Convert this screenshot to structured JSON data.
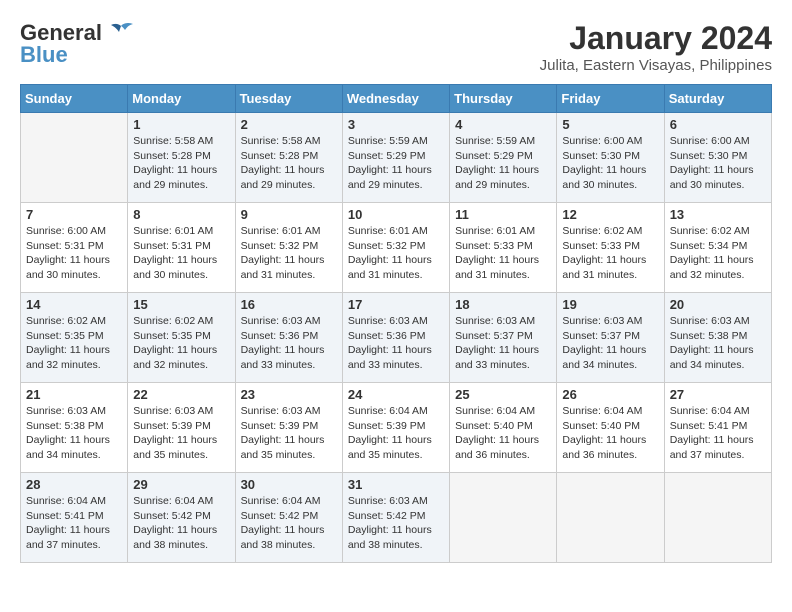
{
  "logo": {
    "general": "General",
    "blue": "Blue"
  },
  "title": "January 2024",
  "subtitle": "Julita, Eastern Visayas, Philippines",
  "headers": [
    "Sunday",
    "Monday",
    "Tuesday",
    "Wednesday",
    "Thursday",
    "Friday",
    "Saturday"
  ],
  "weeks": [
    [
      {
        "day": "",
        "info": ""
      },
      {
        "day": "1",
        "info": "Sunrise: 5:58 AM\nSunset: 5:28 PM\nDaylight: 11 hours and 29 minutes."
      },
      {
        "day": "2",
        "info": "Sunrise: 5:58 AM\nSunset: 5:28 PM\nDaylight: 11 hours and 29 minutes."
      },
      {
        "day": "3",
        "info": "Sunrise: 5:59 AM\nSunset: 5:29 PM\nDaylight: 11 hours and 29 minutes."
      },
      {
        "day": "4",
        "info": "Sunrise: 5:59 AM\nSunset: 5:29 PM\nDaylight: 11 hours and 29 minutes."
      },
      {
        "day": "5",
        "info": "Sunrise: 6:00 AM\nSunset: 5:30 PM\nDaylight: 11 hours and 30 minutes."
      },
      {
        "day": "6",
        "info": "Sunrise: 6:00 AM\nSunset: 5:30 PM\nDaylight: 11 hours and 30 minutes."
      }
    ],
    [
      {
        "day": "7",
        "info": "Sunrise: 6:00 AM\nSunset: 5:31 PM\nDaylight: 11 hours and 30 minutes."
      },
      {
        "day": "8",
        "info": "Sunrise: 6:01 AM\nSunset: 5:31 PM\nDaylight: 11 hours and 30 minutes."
      },
      {
        "day": "9",
        "info": "Sunrise: 6:01 AM\nSunset: 5:32 PM\nDaylight: 11 hours and 31 minutes."
      },
      {
        "day": "10",
        "info": "Sunrise: 6:01 AM\nSunset: 5:32 PM\nDaylight: 11 hours and 31 minutes."
      },
      {
        "day": "11",
        "info": "Sunrise: 6:01 AM\nSunset: 5:33 PM\nDaylight: 11 hours and 31 minutes."
      },
      {
        "day": "12",
        "info": "Sunrise: 6:02 AM\nSunset: 5:33 PM\nDaylight: 11 hours and 31 minutes."
      },
      {
        "day": "13",
        "info": "Sunrise: 6:02 AM\nSunset: 5:34 PM\nDaylight: 11 hours and 32 minutes."
      }
    ],
    [
      {
        "day": "14",
        "info": "Sunrise: 6:02 AM\nSunset: 5:35 PM\nDaylight: 11 hours and 32 minutes."
      },
      {
        "day": "15",
        "info": "Sunrise: 6:02 AM\nSunset: 5:35 PM\nDaylight: 11 hours and 32 minutes."
      },
      {
        "day": "16",
        "info": "Sunrise: 6:03 AM\nSunset: 5:36 PM\nDaylight: 11 hours and 33 minutes."
      },
      {
        "day": "17",
        "info": "Sunrise: 6:03 AM\nSunset: 5:36 PM\nDaylight: 11 hours and 33 minutes."
      },
      {
        "day": "18",
        "info": "Sunrise: 6:03 AM\nSunset: 5:37 PM\nDaylight: 11 hours and 33 minutes."
      },
      {
        "day": "19",
        "info": "Sunrise: 6:03 AM\nSunset: 5:37 PM\nDaylight: 11 hours and 34 minutes."
      },
      {
        "day": "20",
        "info": "Sunrise: 6:03 AM\nSunset: 5:38 PM\nDaylight: 11 hours and 34 minutes."
      }
    ],
    [
      {
        "day": "21",
        "info": "Sunrise: 6:03 AM\nSunset: 5:38 PM\nDaylight: 11 hours and 34 minutes."
      },
      {
        "day": "22",
        "info": "Sunrise: 6:03 AM\nSunset: 5:39 PM\nDaylight: 11 hours and 35 minutes."
      },
      {
        "day": "23",
        "info": "Sunrise: 6:03 AM\nSunset: 5:39 PM\nDaylight: 11 hours and 35 minutes."
      },
      {
        "day": "24",
        "info": "Sunrise: 6:04 AM\nSunset: 5:39 PM\nDaylight: 11 hours and 35 minutes."
      },
      {
        "day": "25",
        "info": "Sunrise: 6:04 AM\nSunset: 5:40 PM\nDaylight: 11 hours and 36 minutes."
      },
      {
        "day": "26",
        "info": "Sunrise: 6:04 AM\nSunset: 5:40 PM\nDaylight: 11 hours and 36 minutes."
      },
      {
        "day": "27",
        "info": "Sunrise: 6:04 AM\nSunset: 5:41 PM\nDaylight: 11 hours and 37 minutes."
      }
    ],
    [
      {
        "day": "28",
        "info": "Sunrise: 6:04 AM\nSunset: 5:41 PM\nDaylight: 11 hours and 37 minutes."
      },
      {
        "day": "29",
        "info": "Sunrise: 6:04 AM\nSunset: 5:42 PM\nDaylight: 11 hours and 38 minutes."
      },
      {
        "day": "30",
        "info": "Sunrise: 6:04 AM\nSunset: 5:42 PM\nDaylight: 11 hours and 38 minutes."
      },
      {
        "day": "31",
        "info": "Sunrise: 6:03 AM\nSunset: 5:42 PM\nDaylight: 11 hours and 38 minutes."
      },
      {
        "day": "",
        "info": ""
      },
      {
        "day": "",
        "info": ""
      },
      {
        "day": "",
        "info": ""
      }
    ]
  ]
}
